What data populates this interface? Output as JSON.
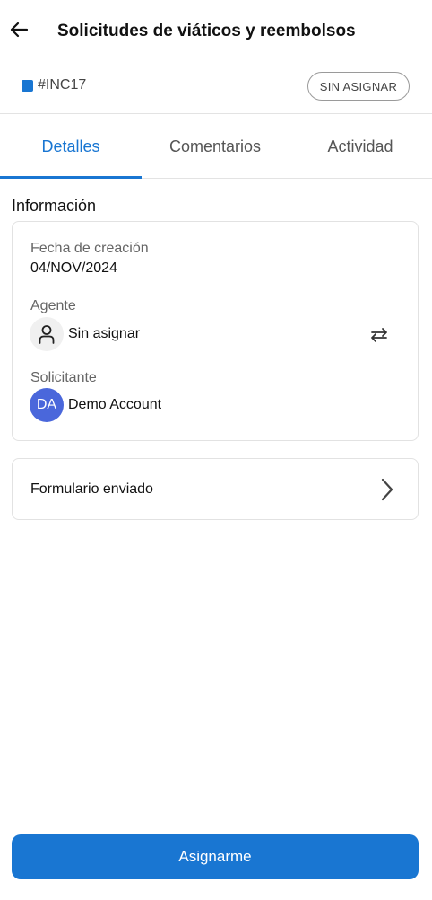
{
  "colors": {
    "accent": "#1976d2",
    "square": "#1976d2",
    "avatar_bg": "#4a67db"
  },
  "header": {
    "title": "Solicitudes de viáticos y reembolsos",
    "back_icon": "arrow-left-icon"
  },
  "ticket": {
    "id": "#INC17",
    "status_badge": "SIN ASIGNAR"
  },
  "tabs": [
    {
      "label": "Detalles",
      "active": true
    },
    {
      "label": "Comentarios",
      "active": false
    },
    {
      "label": "Actividad",
      "active": false
    }
  ],
  "info": {
    "section_title": "Información",
    "creation_date_label": "Fecha de creación",
    "creation_date": "04/NOV/2024",
    "agent_label": "Agente",
    "agent_value": "Sin asignar",
    "agent_icon": "person-icon",
    "swap_icon": "swap-icon",
    "requester_label": "Solicitante",
    "requester_initials": "DA",
    "requester_name": "Demo Account"
  },
  "form": {
    "label": "Formulario enviado",
    "icon": "chevron-right-icon"
  },
  "footer": {
    "assign_button": "Asignarme"
  }
}
